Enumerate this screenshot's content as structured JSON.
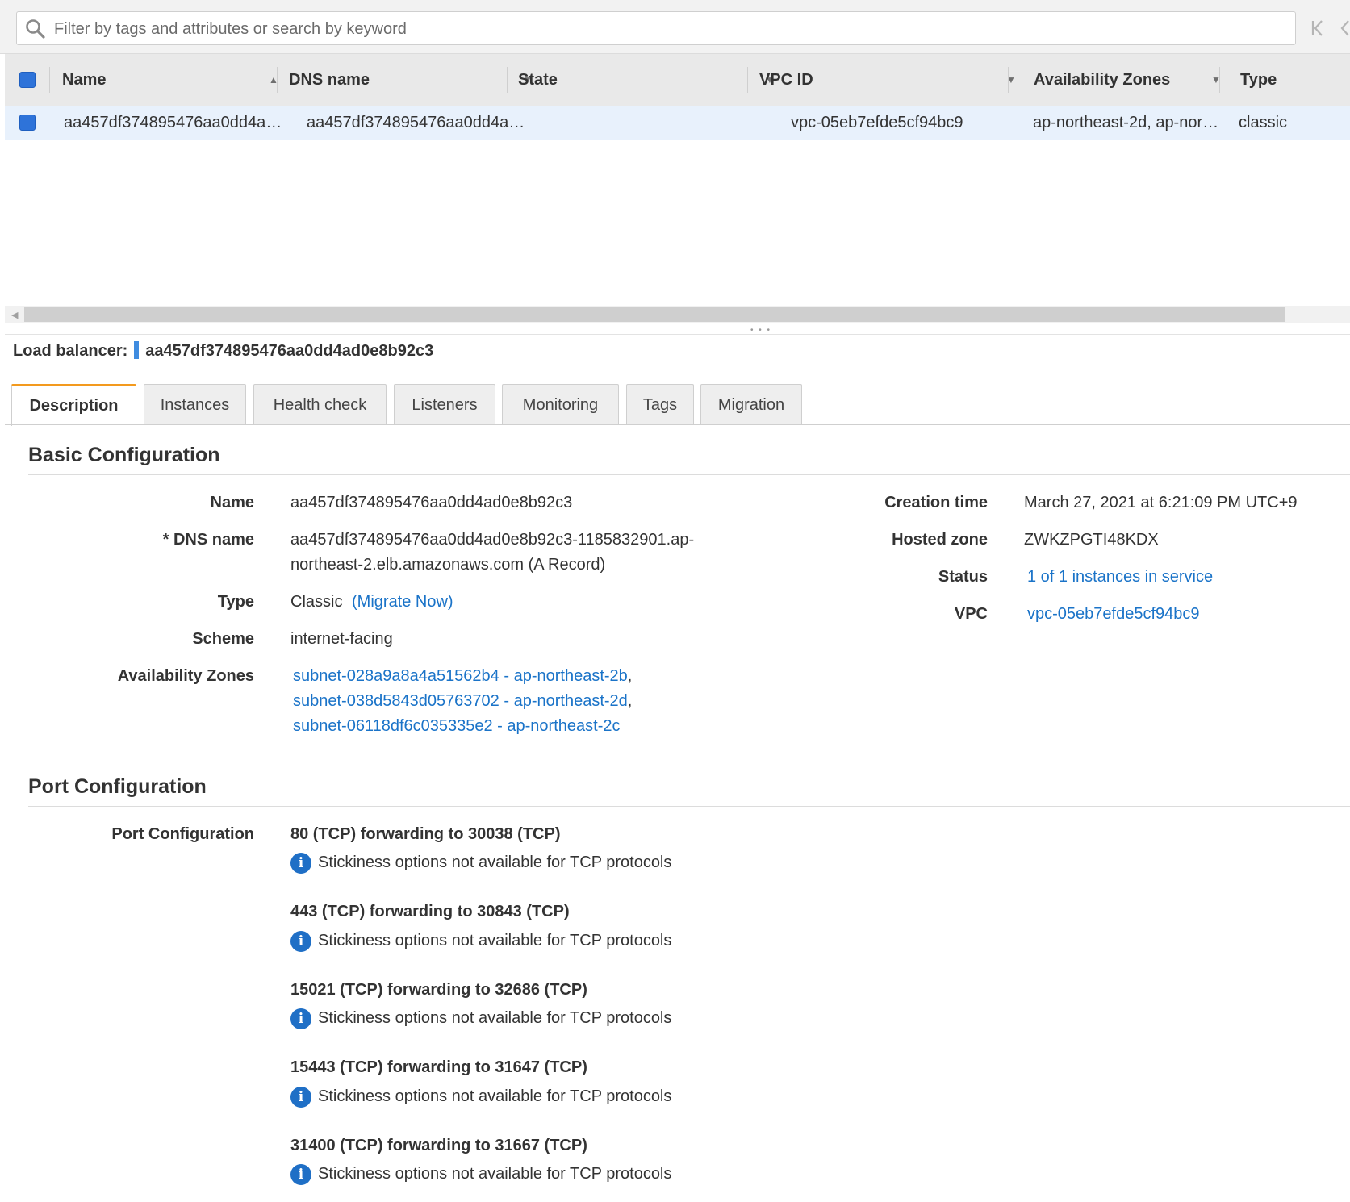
{
  "search": {
    "placeholder": "Filter by tags and attributes or search by keyword"
  },
  "table": {
    "columns": [
      "Name",
      "DNS name",
      "State",
      "VPC ID",
      "Availability Zones",
      "Type"
    ],
    "rows": [
      {
        "name": "aa457df374895476aa0dd4a…",
        "dns": "aa457df374895476aa0dd4a…",
        "state": "",
        "vpc": "vpc-05eb7efde5cf94bc9",
        "azs": "ap-northeast-2d, ap-nor…",
        "type": "classic"
      }
    ]
  },
  "detail": {
    "label": "Load balancer:",
    "name": "aa457df374895476aa0dd4ad0e8b92c3"
  },
  "tabs": [
    "Description",
    "Instances",
    "Health check",
    "Listeners",
    "Monitoring",
    "Tags",
    "Migration"
  ],
  "basic": {
    "title": "Basic Configuration",
    "name_label": "Name",
    "name_value": "aa457df374895476aa0dd4ad0e8b92c3",
    "dns_label": "* DNS name",
    "dns_value_1": "aa457df374895476aa0dd4ad0e8b92c3-1185832901.ap-",
    "dns_value_2": "northeast-2.elb.amazonaws.com (A Record)",
    "type_label": "Type",
    "type_value": "Classic",
    "type_link": "(Migrate Now)",
    "scheme_label": "Scheme",
    "scheme_value": "internet-facing",
    "az_label": "Availability Zones",
    "az_links": [
      "subnet-028a9a8a4a51562b4 - ap-northeast-2b",
      "subnet-038d5843d05763702 - ap-northeast-2d",
      "subnet-06118df6c035335e2 - ap-northeast-2c"
    ],
    "az_sep": ",",
    "creation_label": "Creation time",
    "creation_value": "March 27, 2021 at 6:21:09 PM UTC+9",
    "hosted_label": "Hosted zone",
    "hosted_value": "ZWKZPGTI48KDX",
    "status_label": "Status",
    "status_value": "1 of 1 instances in service",
    "vpc_label": "VPC",
    "vpc_value": "vpc-05eb7efde5cf94bc9"
  },
  "port": {
    "title": "Port Configuration",
    "label": "Port Configuration",
    "items": [
      {
        "rule": "80 (TCP) forwarding to 30038 (TCP)",
        "note": "Stickiness options not available for TCP protocols"
      },
      {
        "rule": "443 (TCP) forwarding to 30843 (TCP)",
        "note": "Stickiness options not available for TCP protocols"
      },
      {
        "rule": "15021 (TCP) forwarding to 32686 (TCP)",
        "note": "Stickiness options not available for TCP protocols"
      },
      {
        "rule": "15443 (TCP) forwarding to 31647 (TCP)",
        "note": "Stickiness options not available for TCP protocols"
      },
      {
        "rule": "31400 (TCP) forwarding to 31667 (TCP)",
        "note": "Stickiness options not available for TCP protocols"
      }
    ]
  },
  "icons": {
    "search": "search-icon",
    "first_page": "first-page-icon",
    "prev_page": "previous-page-icon",
    "info": "info-icon",
    "sort_asc": "sort-ascending-icon",
    "sort": "sort-dropdown-icon"
  },
  "colors": {
    "link": "#1a73c8",
    "selected_row": "#e8f1fc",
    "active_tab_accent": "#f39a1e",
    "checkbox": "#2e73d9",
    "info_icon": "#1f6fc6"
  }
}
